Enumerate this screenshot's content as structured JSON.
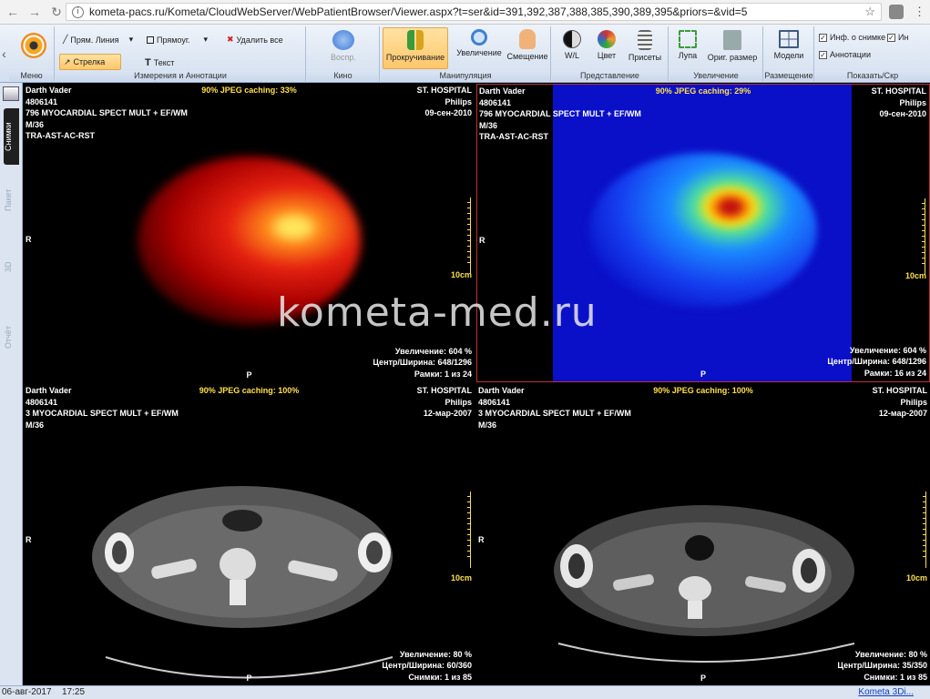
{
  "browser": {
    "url": "kometa-pacs.ru/Kometa/CloudWebServer/WebPatientBrowser/Viewer.aspx?t=ser&id=391,392,387,388,385,390,389,395&priors=&vid=5",
    "back": "←",
    "forward": "→",
    "reload": "↻",
    "star": "☆",
    "menu": "⋮"
  },
  "ribbon": {
    "menu": {
      "label": "Меню"
    },
    "measure": {
      "line": "Прям. Линия",
      "rect": "Прямоуг.",
      "delete_all": "Удалить все",
      "arrow": "Стрелка",
      "text": "Текст",
      "group": "Измерения и Аннотации"
    },
    "cine": {
      "play": "Воспр.",
      "group": "Кино"
    },
    "manip": {
      "scroll": "Прокручивание",
      "zoom": "Увеличение",
      "pan": "Смещение",
      "group": "Манипуляция"
    },
    "present": {
      "wl": "W/L",
      "color": "Цвет",
      "presets": "Присеты",
      "group": "Представление"
    },
    "magnify": {
      "loupe": "Лупа",
      "orig": "Ориг. размер",
      "group": "Увеличение"
    },
    "layout": {
      "models": "Модели",
      "group": "Размещение"
    },
    "show": {
      "info": "Инф. о снимке",
      "info2": "Ин",
      "annot": "Аннотации",
      "group": "Показать/Скр"
    }
  },
  "sidetabs": [
    "Снимки",
    "Пакет",
    "3D",
    "Отчёт"
  ],
  "watermark": "kometa-med.ru",
  "viewports": [
    {
      "name": "Darth Vader",
      "id": "4806141",
      "series": "796 MYOCARDIAL SPECT MULT + EF/WM",
      "age": "M/36",
      "tag": "TRA-AST-AC-RST",
      "caching": "90% JPEG caching: 33%",
      "hospital": "ST. HOSPITAL",
      "vendor": "Philips",
      "date": "09-сен-2010",
      "zoom": "Увеличение: 604 %",
      "wl": "Центр/Ширина: 648/1296",
      "frame": "Рамки: 1 из 24",
      "R": "R",
      "P": "P",
      "scale": "10cm"
    },
    {
      "name": "Darth Vader",
      "id": "4806141",
      "series": "796 MYOCARDIAL SPECT MULT + EF/WM",
      "age": "M/36",
      "tag": "TRA-AST-AC-RST",
      "caching": "90% JPEG caching: 29%",
      "hospital": "ST. HOSPITAL",
      "vendor": "Philips",
      "date": "09-сен-2010",
      "zoom": "Увеличение: 604 %",
      "wl": "Центр/Ширина: 648/1296",
      "frame": "Рамки: 16 из 24",
      "R": "R",
      "P": "P",
      "scale": "10cm"
    },
    {
      "name": "Darth Vader",
      "id": "4806141",
      "series": "3 MYOCARDIAL SPECT MULT + EF/WM",
      "age": "M/36",
      "tag": "",
      "caching": "90% JPEG caching: 100%",
      "hospital": "ST. HOSPITAL",
      "vendor": "Philips",
      "date": "12-мар-2007",
      "zoom": "Увеличение: 80 %",
      "wl": "Центр/Ширина: 60/360",
      "frame": "Снимки: 1 из 85",
      "R": "R",
      "P": "P",
      "scale": "10cm"
    },
    {
      "name": "Darth Vader",
      "id": "4806141",
      "series": "3 MYOCARDIAL SPECT MULT + EF/WM",
      "age": "M/36",
      "tag": "",
      "caching": "90% JPEG caching: 100%",
      "hospital": "ST. HOSPITAL",
      "vendor": "Philips",
      "date": "12-мар-2007",
      "zoom": "Увеличение: 80 %",
      "wl": "Центр/Ширина: 35/350",
      "frame": "Снимки: 1 из 85",
      "R": "R",
      "P": "P",
      "scale": "10cm"
    }
  ],
  "status": {
    "date": "06-авг-2017",
    "time": "17:25",
    "link": "Kometa 3Di..."
  }
}
